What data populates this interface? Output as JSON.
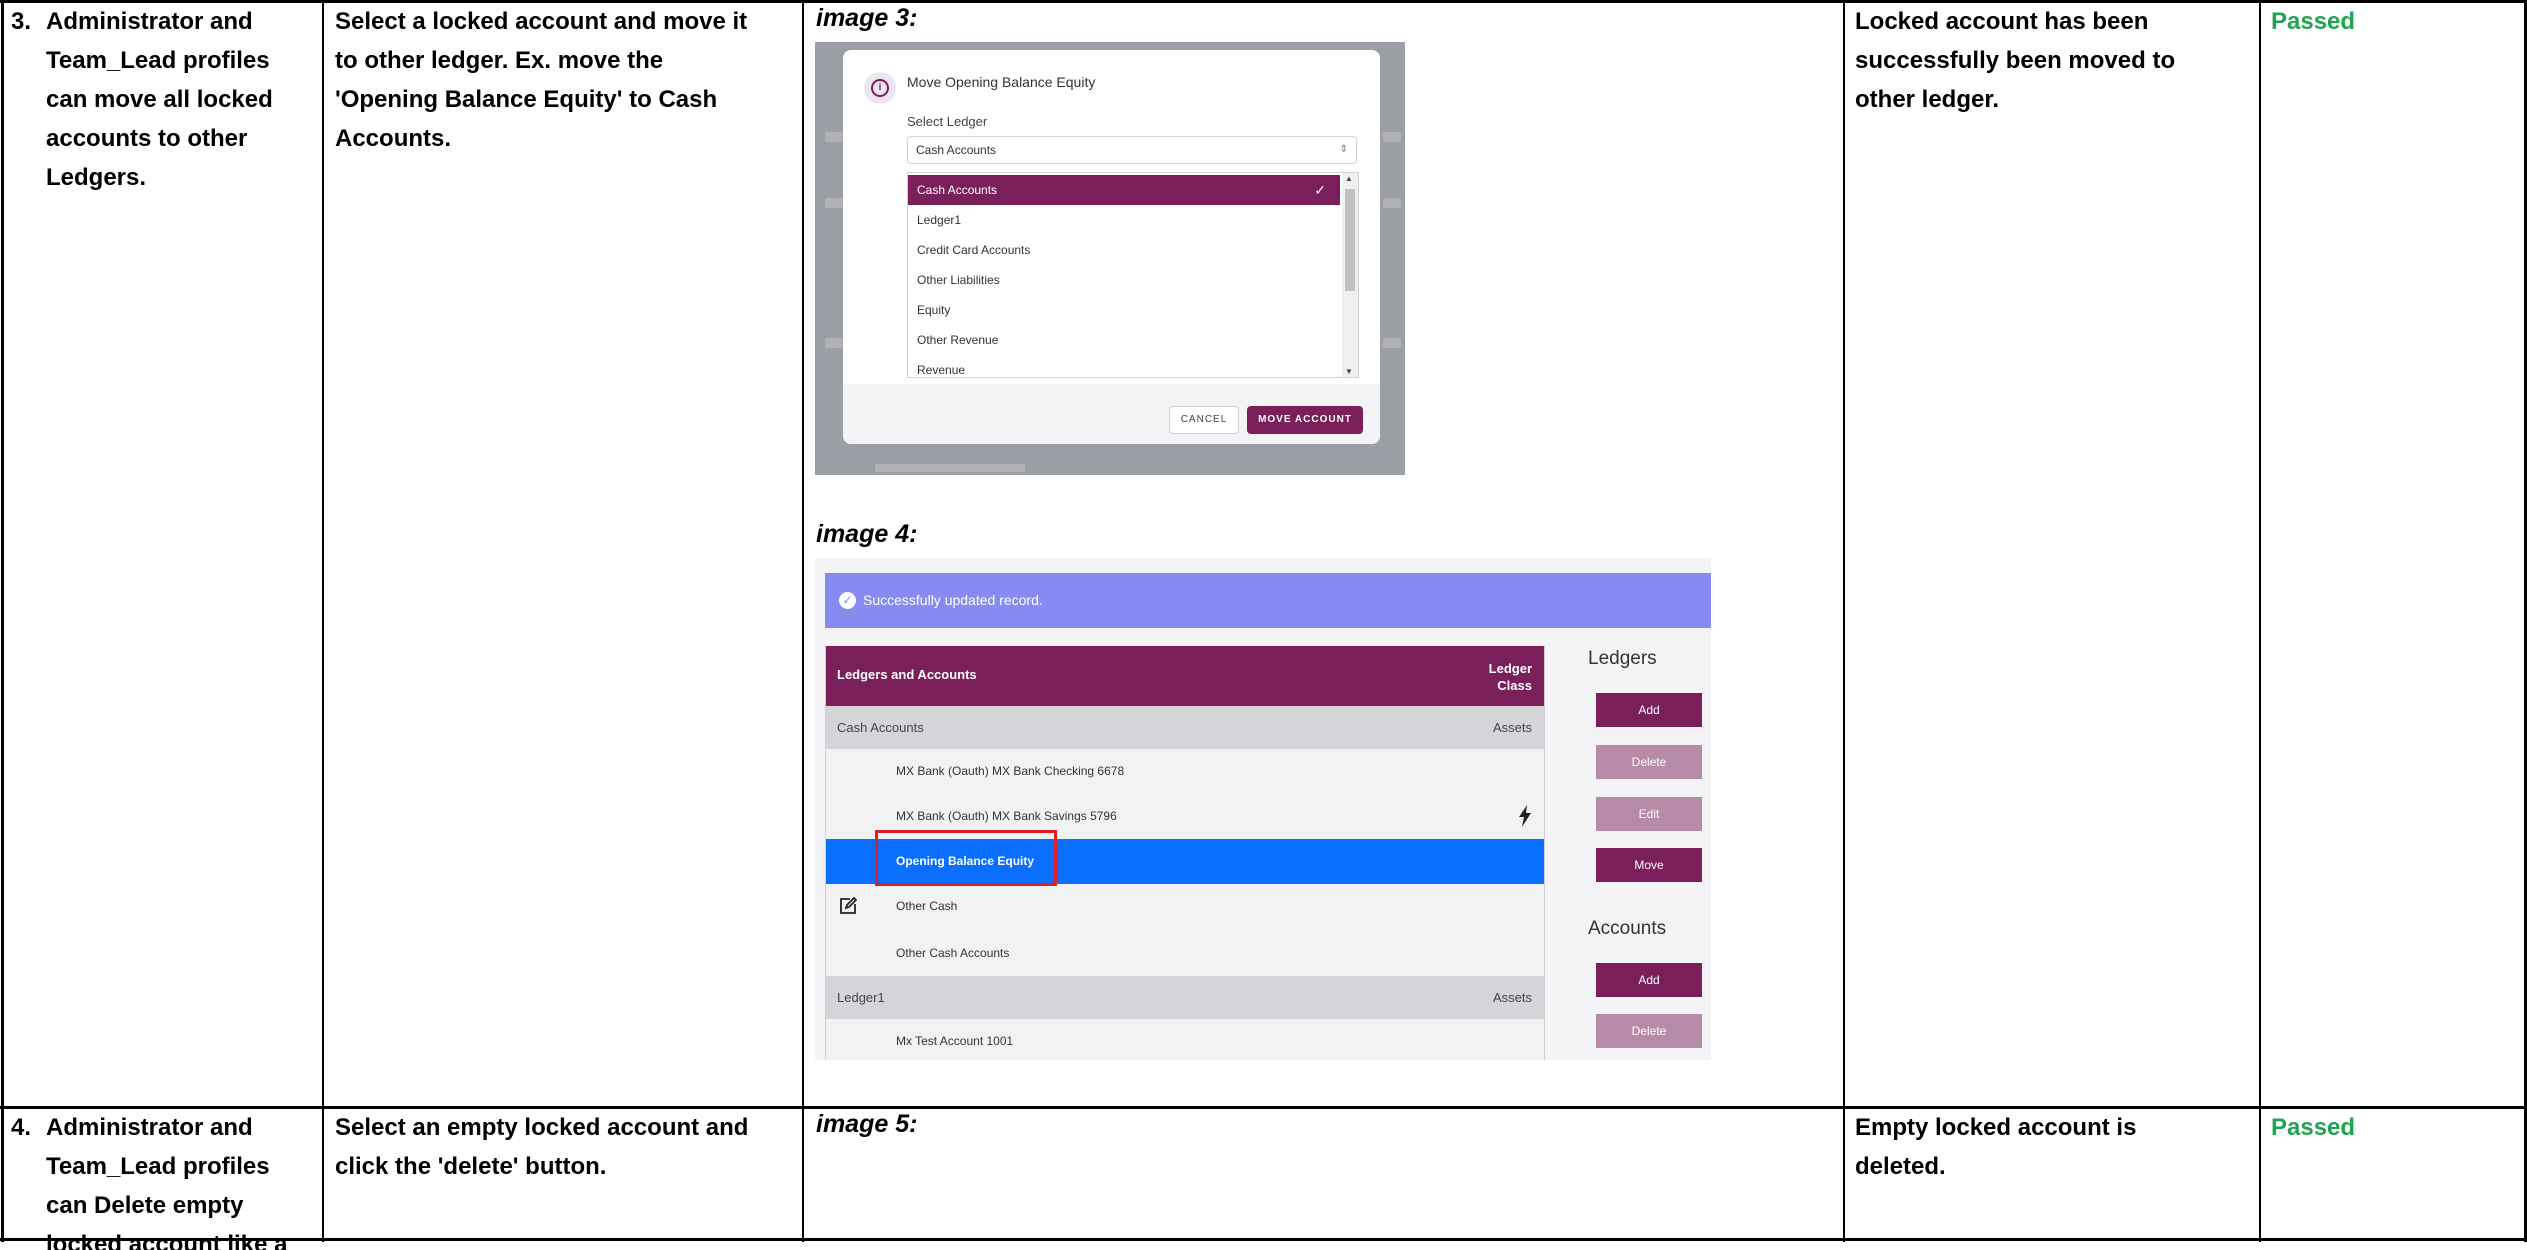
{
  "rows": [
    {
      "number": "3.",
      "scenario": [
        "Administrator and",
        "Team_Lead profiles",
        "can move all locked",
        "accounts to other",
        "Ledgers."
      ],
      "steps": [
        "Select a locked account and move it",
        "to other ledger. Ex. move the",
        "'Opening Balance Equity' to Cash",
        "Accounts."
      ],
      "expected": [
        "Locked account has been",
        "successfully been moved to",
        "other ledger."
      ],
      "result": "Passed",
      "images": [
        {
          "label": "image 3:",
          "dialog": {
            "title": "Move Opening Balance Equity",
            "select_label": "Select Ledger",
            "selected_value": "Cash Accounts",
            "options": [
              "Cash Accounts",
              "Ledger1",
              "Credit Card Accounts",
              "Other Liabilities",
              "Equity",
              "Other Revenue",
              "Revenue"
            ],
            "cancel_label": "CANCEL",
            "move_label": "MOVE ACCOUNT"
          }
        },
        {
          "label": "image 4:",
          "banner": "Successfully updated record.",
          "table_header": {
            "left": "Ledgers and Accounts",
            "right_line1": "Ledger",
            "right_line2": "Class"
          },
          "groups": [
            {
              "name": "Cash Accounts",
              "class": "Assets",
              "accounts": [
                "MX Bank (Oauth) MX Bank Checking 6678",
                "MX Bank (Oauth) MX Bank Savings 5796",
                "Opening Balance Equity",
                "Other Cash",
                "Other Cash Accounts"
              ]
            },
            {
              "name": "Ledger1",
              "class": "Assets",
              "accounts": [
                "Mx Test Account 1001"
              ]
            }
          ],
          "ledgers_title": "Ledgers",
          "ledger_buttons": [
            "Add",
            "Delete",
            "Edit",
            "Move"
          ],
          "accounts_title": "Accounts",
          "account_buttons": [
            "Add",
            "Delete"
          ]
        }
      ]
    },
    {
      "number": "4.",
      "scenario": [
        "Administrator and",
        "Team_Lead profiles",
        "can Delete empty",
        "locked account like a"
      ],
      "steps": [
        "Select an empty locked account and",
        "click the 'delete' button."
      ],
      "expected": [
        "Empty locked account is",
        "deleted."
      ],
      "result": "Passed",
      "images": [
        {
          "label": "image 5:"
        }
      ]
    }
  ],
  "colors": {
    "passed": "#1fa44f",
    "brand": "#7a1f59",
    "highlight": "#0a6fff",
    "banner": "#858bf0"
  }
}
